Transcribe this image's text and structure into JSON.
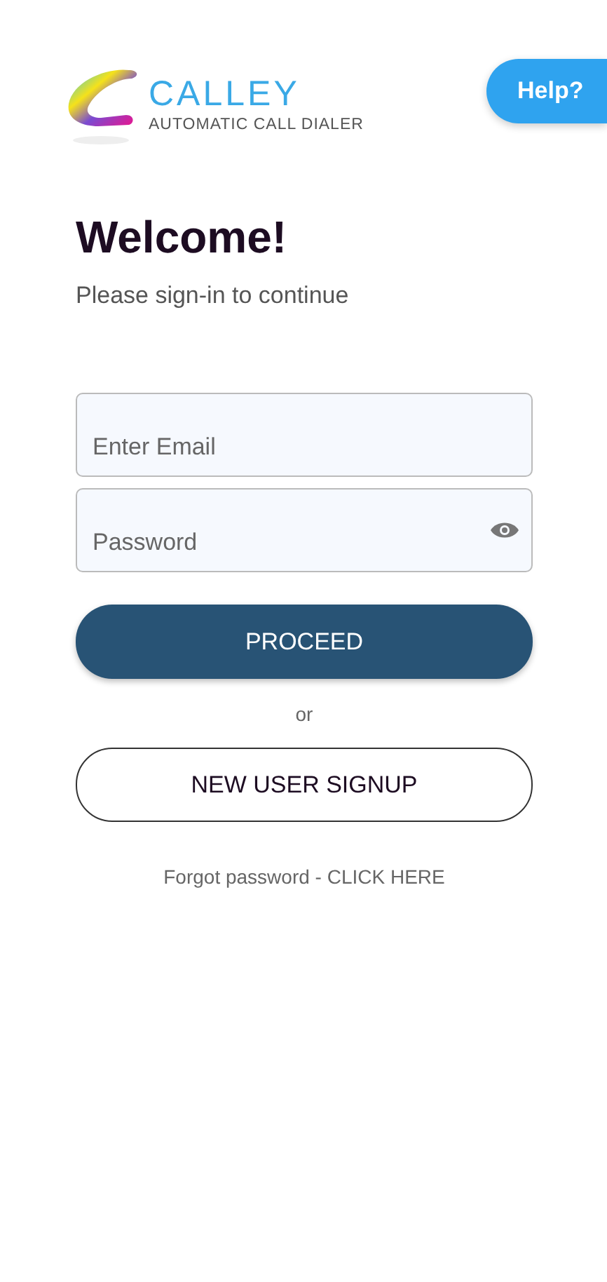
{
  "logo": {
    "name": "CALLEY",
    "tagline": "AUTOMATIC CALL DIALER"
  },
  "help_button": "Help?",
  "heading": "Welcome!",
  "subheading": "Please sign-in to continue",
  "fields": [
    {
      "kind": "email",
      "placeholder": "Enter Email"
    },
    {
      "kind": "password",
      "placeholder": "Password"
    }
  ],
  "proceed_button": "PROCEED",
  "separator": "or",
  "signup_button": "NEW USER SIGNUP",
  "forgot_link": "Forgot password - CLICK HERE"
}
